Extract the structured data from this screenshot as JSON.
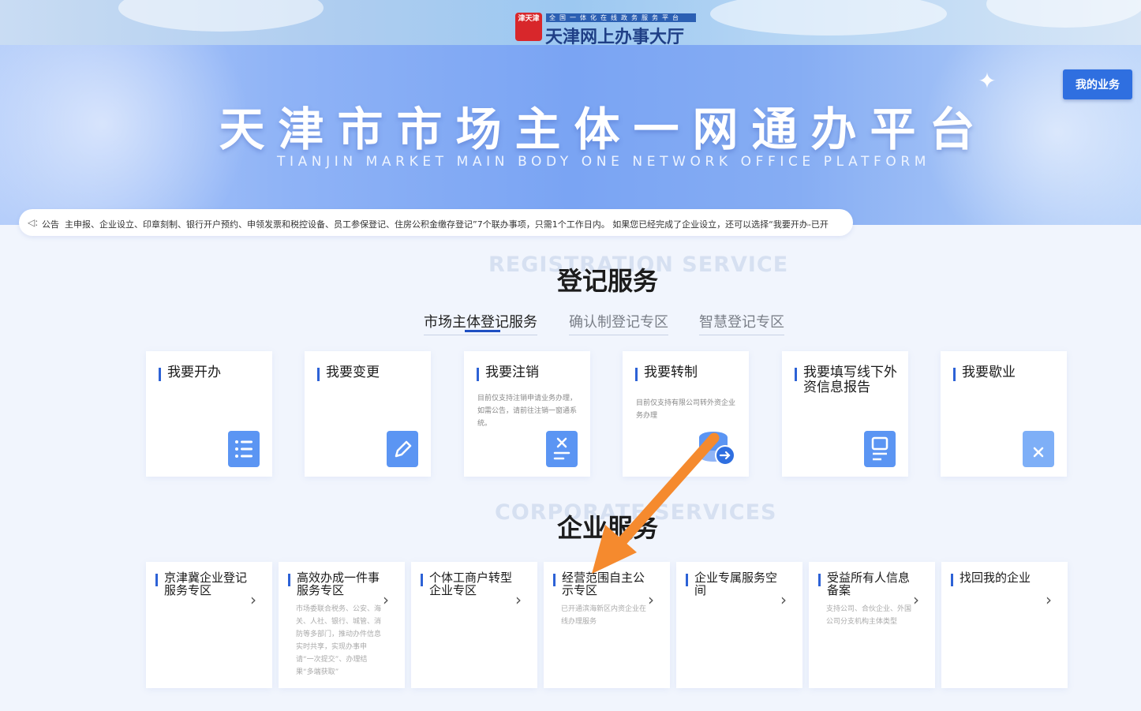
{
  "header": {
    "logo_text": "津天津",
    "subtitle": "全国一体化在线政务服务平台",
    "title": "天津网上办事大厅"
  },
  "banner": {
    "title": "天津市市场主体一网通办平台",
    "subtitle": "TIANJIN MARKET MAIN BODY ONE NETWORK OFFICE PLATFORM",
    "my_business": "我的业务"
  },
  "notice": {
    "label": "公告",
    "text": "主申报、企业设立、印章刻制、银行开户预约、申领发票和税控设备、员工参保登记、住房公积金缴存登记”7个联办事项，只需1个工作日内。 如果您已经完成了企业设立，还可以选择“我要开办-已开"
  },
  "registration": {
    "bg_text": "REGISTRATION SERVICE",
    "title": "登记服务",
    "tabs": [
      "市场主体登记服务",
      "确认制登记专区",
      "智慧登记专区"
    ],
    "cards": [
      {
        "title": "我要开办",
        "desc": "",
        "icon": "list-doc-icon"
      },
      {
        "title": "我要变更",
        "desc": "",
        "icon": "edit-doc-icon"
      },
      {
        "title": "我要注销",
        "desc": "目前仅支持注销申请业务办理，如需公告，请前往注销一窗通系统。",
        "icon": "cancel-doc-icon"
      },
      {
        "title": "我要转制",
        "desc": "目前仅支持有限公司转外资企业务办理",
        "icon": "convert-db-icon"
      },
      {
        "title": "我要填写线下外资信息报告",
        "desc": "",
        "icon": "report-doc-icon"
      },
      {
        "title": "我要歇业",
        "desc": "",
        "icon": "close-folder-icon"
      }
    ]
  },
  "enterprise": {
    "bg_text": "CORPORATE SERVICES",
    "title": "企业服务",
    "cards": [
      {
        "title": "京津冀企业登记服务专区",
        "desc": ""
      },
      {
        "title": "高效办成一件事服务专区",
        "desc": "市场委联合税务、公安、海关、人社、银行、城管、消防等多部门，推动办件信息实时共享，实现办事申请“一次提交”、办理结果“多端获取”"
      },
      {
        "title": "个体工商户转型企业专区",
        "desc": ""
      },
      {
        "title": "经营范围自主公示专区",
        "desc": "已开通滨海新区内资企业在线办理服务"
      },
      {
        "title": "企业专属服务空间",
        "desc": ""
      },
      {
        "title": "受益所有人信息备案",
        "desc": "支持公司、合伙企业、外国公司分支机构主体类型"
      },
      {
        "title": "找回我的企业",
        "desc": ""
      }
    ]
  },
  "colors": {
    "accent": "#2d62d6",
    "button": "#2f6fe0",
    "icon": "#5b95f3",
    "annotation_arrow": "#f58a2e"
  }
}
